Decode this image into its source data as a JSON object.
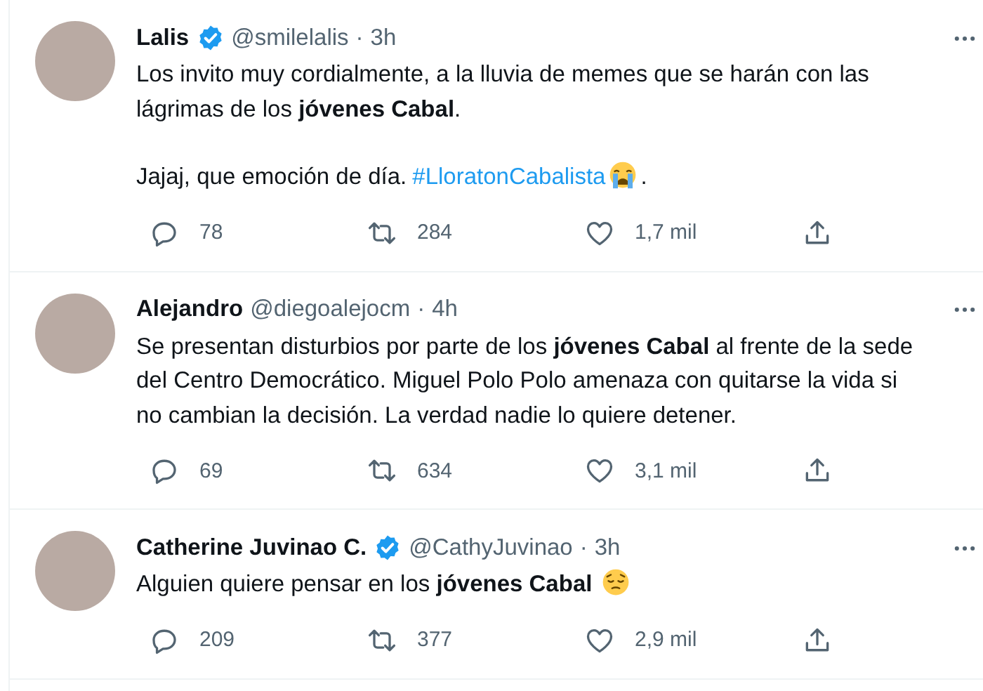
{
  "tweets": [
    {
      "name": "Lalis",
      "verified": true,
      "handle": "@smilelalis",
      "separator": "·",
      "time": "3h",
      "paragraphs": [
        [
          {
            "kind": "text",
            "text": "Los invito muy cordialmente, a la lluvia de memes que se harán con las lágrimas de los **jóvenes Cabal**."
          }
        ],
        [
          {
            "kind": "text",
            "text": "Jajaj, que emoción de día."
          },
          {
            "kind": "hashtag",
            "text": "#LloratonCabalista"
          },
          {
            "kind": "crying-emoji"
          },
          {
            "kind": "text",
            "text": "."
          }
        ]
      ],
      "actions": [
        {
          "kind": "reply",
          "count": "78"
        },
        {
          "kind": "retweet",
          "count": "284"
        },
        {
          "kind": "like",
          "count": "1,7 mil"
        },
        {
          "kind": "share"
        }
      ]
    },
    {
      "name": "Alejandro",
      "verified": false,
      "handle": "@diegoalejocm",
      "separator": "·",
      "time": "4h",
      "paragraphs": [
        [
          {
            "kind": "text",
            "text": "Se presentan disturbios por parte de los **jóvenes Cabal** al frente de la sede del Centro Democrático. Miguel Polo Polo amenaza con quitarse la vida si no cambian la decisión. La verdad nadie lo quiere detener."
          }
        ]
      ],
      "actions": [
        {
          "kind": "reply",
          "count": "69"
        },
        {
          "kind": "retweet",
          "count": "634"
        },
        {
          "kind": "like",
          "count": "3,1 mil"
        },
        {
          "kind": "share"
        }
      ]
    },
    {
      "name": "Catherine Juvinao C.",
      "verified": true,
      "handle": "@CathyJuvinao",
      "separator": "·",
      "time": "3h",
      "paragraphs": [
        [
          {
            "kind": "text",
            "text": "Alguien quiere pensar en los **jóvenes Cabal**"
          },
          {
            "kind": "pensive-emoji"
          }
        ]
      ],
      "actions": [
        {
          "kind": "reply",
          "count": "209"
        },
        {
          "kind": "retweet",
          "count": "377"
        },
        {
          "kind": "like",
          "count": "2,9 mil"
        },
        {
          "kind": "share"
        }
      ]
    }
  ]
}
